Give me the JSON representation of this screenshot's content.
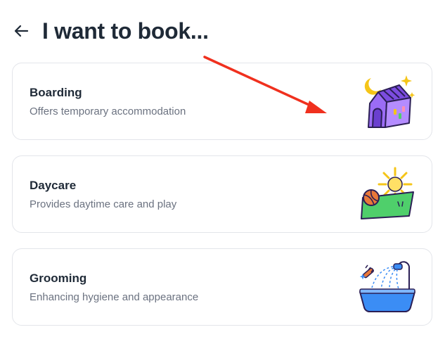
{
  "header": {
    "back_icon": "arrow-left-icon",
    "title": "I want to book..."
  },
  "options": [
    {
      "title": "Boarding",
      "description": "Offers temporary accommodation",
      "icon": "house-moon-icon"
    },
    {
      "title": "Daycare",
      "description": "Provides daytime care and play",
      "icon": "sun-ball-icon"
    },
    {
      "title": "Grooming",
      "description": "Enhancing hygiene and appearance",
      "icon": "bathtub-shower-icon"
    }
  ],
  "annotation": {
    "type": "arrow",
    "color": "#f0301e"
  },
  "colors": {
    "text_primary": "#1f2a37",
    "text_secondary": "#6b7280",
    "card_border": "#e3e5ea",
    "purple": "#9b6cf5",
    "moon_yellow": "#f5c518",
    "grass_green": "#4fcf6b",
    "ball_orange": "#e8783a",
    "tub_blue": "#3b8df5"
  }
}
